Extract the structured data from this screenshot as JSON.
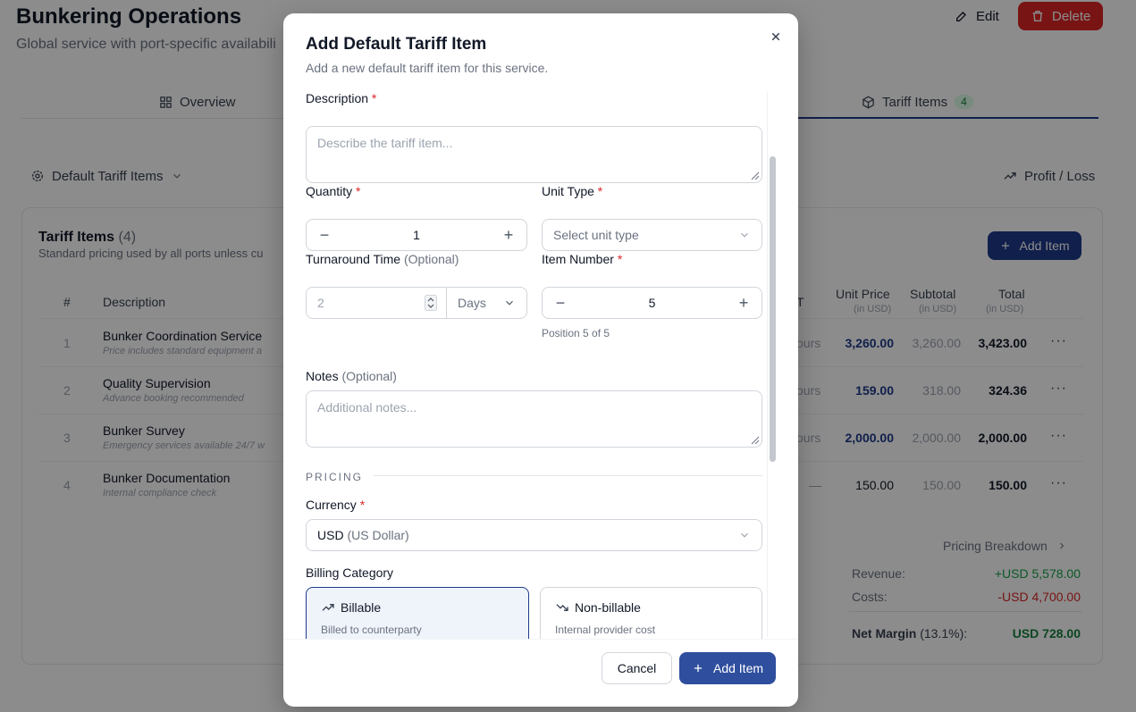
{
  "page": {
    "title": "Bunkering Operations",
    "subtitle": "Global service with port-specific availabili",
    "edit_label": "Edit",
    "delete_label": "Delete"
  },
  "tabs": [
    {
      "label": "Overview"
    },
    {
      "label": "Tariff Items",
      "badge": "4"
    }
  ],
  "toolbar": {
    "filter_label": "Default Tariff Items",
    "profit_label": "Profit / Loss"
  },
  "card": {
    "title": "Tariff Items",
    "count": "(4)",
    "subtitle": "Standard pricing used by all ports unless cu",
    "add_label": "Add Item"
  },
  "table": {
    "headers": {
      "num": "#",
      "description": "Description",
      "col_t": "T",
      "unit_price": "Unit Price",
      "subtotal": "Subtotal",
      "total": "Total",
      "in_usd": "(in USD)"
    },
    "rows": [
      {
        "num": "1",
        "name": "Bunker Coordination Service",
        "note": "Price includes standard equipment a",
        "time": "ours",
        "unit_price": "3,260.00",
        "subtotal": "3,260.00",
        "total": "3,423.00"
      },
      {
        "num": "2",
        "name": "Quality Supervision",
        "note": "Advance booking recommended",
        "time": "ours",
        "unit_price": "159.00",
        "subtotal": "318.00",
        "total": "324.36"
      },
      {
        "num": "3",
        "name": "Bunker Survey",
        "note": "Emergency services available 24/7 w",
        "time": "ours",
        "unit_price": "2,000.00",
        "subtotal": "2,000.00",
        "total": "2,000.00"
      },
      {
        "num": "4",
        "name": "Bunker Documentation",
        "note": "Internal compliance check",
        "time": "—",
        "unit_price": "150.00",
        "subtotal": "150.00",
        "total": "150.00"
      }
    ]
  },
  "summary": {
    "link": "Pricing Breakdown",
    "revenue_label": "Revenue:",
    "revenue": "+USD 5,578.00",
    "costs_label": "Costs:",
    "costs": "-USD 4,700.00",
    "net_label": "Net Margin",
    "net_pct": "(13.1%):",
    "net": "USD 728.00"
  },
  "modal": {
    "title": "Add Default Tariff Item",
    "subtitle": "Add a new default tariff item for this service.",
    "description": {
      "label": "Description",
      "placeholder": "Describe the tariff item..."
    },
    "quantity": {
      "label": "Quantity",
      "value": "1"
    },
    "unit_type": {
      "label": "Unit Type",
      "placeholder": "Select unit type"
    },
    "turnaround": {
      "label": "Turnaround Time",
      "optional": "(Optional)",
      "value": "2",
      "unit": "Days"
    },
    "item_number": {
      "label": "Item Number",
      "value": "5",
      "helper": "Position 5 of 5"
    },
    "notes": {
      "label": "Notes",
      "optional": "(Optional)",
      "placeholder": "Additional notes..."
    },
    "pricing_section": "PRICING",
    "currency": {
      "label": "Currency",
      "code": "USD",
      "name": "(US Dollar)"
    },
    "billing": {
      "label": "Billing Category",
      "billable_title": "Billable",
      "billable_desc": "Billed to counterparty",
      "nonbillable_title": "Non-billable",
      "nonbillable_desc": "Internal provider cost"
    },
    "cancel_label": "Cancel",
    "submit_label": "Add Item"
  },
  "colors": {
    "primary": "#1e3a8a",
    "danger": "#dc2626",
    "success": "#16a34a"
  }
}
